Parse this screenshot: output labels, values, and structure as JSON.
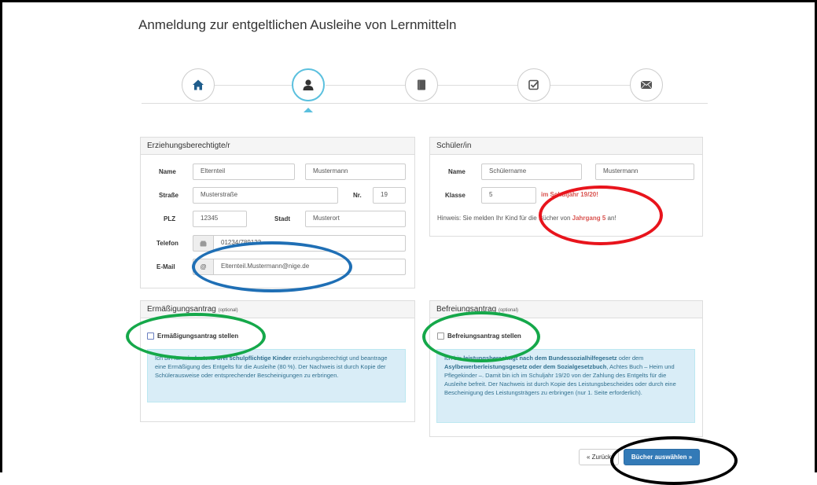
{
  "page": {
    "title": "Anmeldung zur entgeltlichen Ausleihe von Lernmitteln"
  },
  "steps": [
    {
      "icon": "home-icon",
      "active": false
    },
    {
      "icon": "user-icon",
      "active": true
    },
    {
      "icon": "book-icon",
      "active": false
    },
    {
      "icon": "check-square-icon",
      "active": false
    },
    {
      "icon": "envelope-icon",
      "active": false
    }
  ],
  "guardian": {
    "heading": "Erziehungsberechtigte/r",
    "name_label": "Name",
    "first_name": "Elternteil",
    "last_name": "Mustermann",
    "street_label": "Straße",
    "street": "Musterstraße",
    "number_label": "Nr.",
    "number": "19",
    "zip_label": "PLZ",
    "zip": "12345",
    "city_label": "Stadt",
    "city": "Musterort",
    "phone_label": "Telefon",
    "phone": "01234/789123",
    "email_label": "E-Mail",
    "email_addon": "@",
    "email": "Elternteil.Mustermann@nige.de"
  },
  "student": {
    "heading": "Schüler/in",
    "name_label": "Name",
    "first_name": "Schülername",
    "last_name": "Mustermann",
    "class_label": "Klasse",
    "class_value": "5",
    "school_year_note": "im Schuljahr 19/20!",
    "hint_prefix": "Hinweis: Sie melden Ihr Kind für die Bücher von ",
    "hint_highlight": "Jahrgang 5",
    "hint_suffix": " an!"
  },
  "reduction": {
    "heading": "Ermäßigungsantrag",
    "optional": "(optional)",
    "checkbox_label": "Ermäßigungsantrag stellen",
    "info_1": "Ich bin für ",
    "info_bold": "mindestens drei schulpflichtige Kinder",
    "info_2": " erziehungsberechtigt und beantrage eine Ermäßigung des Entgelts für die Ausleihe (80 %). Der Nachweis ist durch Kopie der Schülerausweise oder entsprechender Bescheinigungen zu erbringen."
  },
  "exemption": {
    "heading": "Befreiungsantrag",
    "optional": "(optional)",
    "checkbox_label": "Befreiungsantrag stellen",
    "info_1": "Ich bin ",
    "info_bold_1": "leistungsberechtigt nach dem Bundessozialhilfegesetz",
    "info_2": " oder dem ",
    "info_bold_2": "Asylbewerberleistungsgesetz oder dem Sozialgesetzbuch",
    "info_3": ", Achtes Buch – Heim und Pflegekinder –. Damit bin ich im Schuljahr 19/20 von der Zahlung des Entgelts für die Ausleihe befreit. Der Nachweis ist durch Kopie des Leistungsbescheides oder durch eine Bescheinigung des Leistungsträgers zu erbringen (nur 1. Seite erforderlich)."
  },
  "buttons": {
    "back": "« Zurück",
    "next": "Bücher auswählen »"
  },
  "colors": {
    "primary": "#337ab7",
    "info_bg": "#d9edf7",
    "active_step": "#5bc0de",
    "annotation_blue": "#1f6fb5",
    "annotation_red": "#e8141c",
    "annotation_green": "#15a84a",
    "annotation_black": "#000000"
  }
}
